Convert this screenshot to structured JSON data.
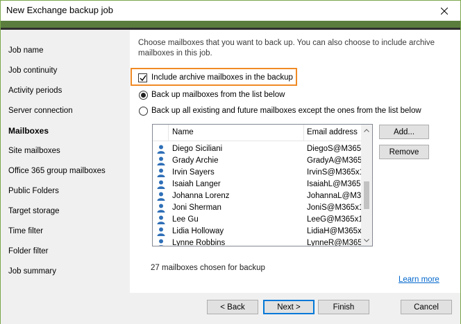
{
  "window": {
    "title": "New Exchange backup job",
    "accent_color": "#5a7d3e",
    "close_icon": "close-icon"
  },
  "sidebar": {
    "items": [
      {
        "label": "Job name",
        "active": false
      },
      {
        "label": "Job continuity",
        "active": false
      },
      {
        "label": "Activity periods",
        "active": false
      },
      {
        "label": "Server connection",
        "active": false
      },
      {
        "label": "Mailboxes",
        "active": true
      },
      {
        "label": "Site mailboxes",
        "active": false
      },
      {
        "label": "Office 365 group mailboxes",
        "active": false
      },
      {
        "label": "Public Folders",
        "active": false
      },
      {
        "label": "Target storage",
        "active": false
      },
      {
        "label": "Time filter",
        "active": false
      },
      {
        "label": "Folder filter",
        "active": false
      },
      {
        "label": "Job summary",
        "active": false
      }
    ]
  },
  "main": {
    "intro": "Choose mailboxes that you want to back up. You can also choose to include archive mailboxes in this job.",
    "include_archive": {
      "label": "Include archive mailboxes in the backup",
      "checked": true,
      "highlight_color": "#f08a24"
    },
    "radio_options": [
      {
        "label": "Back up mailboxes from the list below",
        "selected": true
      },
      {
        "label": "Back up all existing and future mailboxes except the ones from the list below",
        "selected": false
      }
    ],
    "list": {
      "columns": [
        "Name",
        "Email address"
      ],
      "rows": [
        {
          "name": "Diego Siciliani",
          "email": "DiegoS@M365x"
        },
        {
          "name": "Grady Archie",
          "email": "GradyA@M365x"
        },
        {
          "name": "Irvin Sayers",
          "email": "IrvinS@M365x1"
        },
        {
          "name": "Isaiah Langer",
          "email": "IsaiahL@M365"
        },
        {
          "name": "Johanna Lorenz",
          "email": "JohannaL@M36"
        },
        {
          "name": "Joni Sherman",
          "email": "JoniS@M365x1"
        },
        {
          "name": "Lee Gu",
          "email": "LeeG@M365x1"
        },
        {
          "name": "Lidia Holloway",
          "email": "LidiaH@M365x"
        },
        {
          "name": "Lynne Robbins",
          "email": "LynneR@M365"
        }
      ]
    },
    "add_button": "Add...",
    "remove_button": "Remove",
    "count_text": "27 mailboxes chosen for backup",
    "learn_more": "Learn more"
  },
  "footer": {
    "back": "< Back",
    "next": "Next >",
    "finish": "Finish",
    "cancel": "Cancel"
  }
}
